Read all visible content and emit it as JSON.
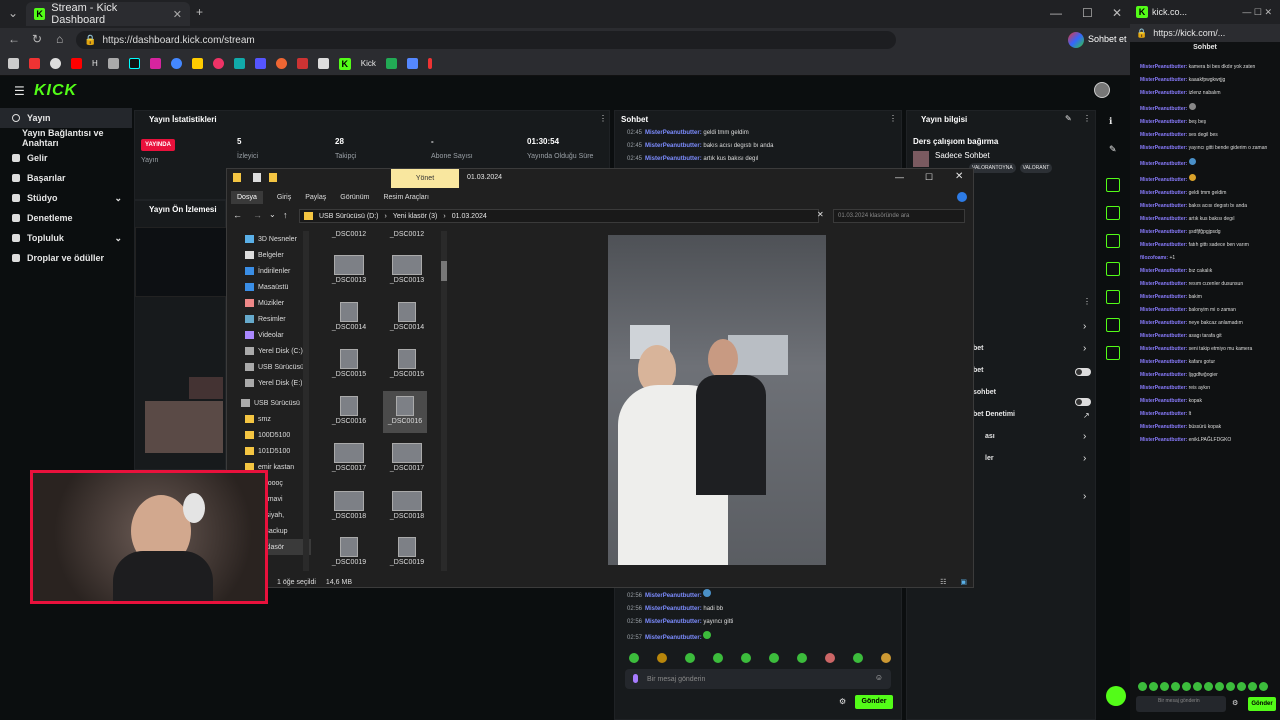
{
  "browser": {
    "tab_title": "Stream - Kick Dashboard",
    "url": "https://dashboard.kick.com/stream",
    "chat_label": "Sohbet et",
    "bookmarks": [
      "H",
      "Kick"
    ]
  },
  "sidebar": {
    "items": [
      {
        "label": "Yayın",
        "active": true
      },
      {
        "label": "Yayın Bağlantısı ve Anahtarı"
      },
      {
        "label": "Gelir"
      },
      {
        "label": "Başarılar"
      },
      {
        "label": "Stüdyo"
      },
      {
        "label": "Denetleme"
      },
      {
        "label": "Topluluk"
      },
      {
        "label": "Droplar ve ödüller"
      }
    ]
  },
  "stats": {
    "title": "Yayın İstatistikleri",
    "status": "YAYINDA",
    "status_label": "Yayın",
    "viewers": "5",
    "viewers_label": "İzleyici",
    "followers": "28",
    "followers_label": "Takipçi",
    "subs": "-",
    "subs_label": "Abone Sayısı",
    "uptime": "01:30:54",
    "uptime_label": "Yayında Olduğu Süre"
  },
  "preview_title": "Yayın Ön İzlemesi",
  "chat": {
    "title": "Sohbet",
    "top_messages": [
      {
        "time": "02:45",
        "user": "MisterPeanutbutter:",
        "text": "geldi tmm geldim"
      },
      {
        "time": "02:45",
        "user": "MisterPeanutbutter:",
        "text": "bakıs acısı degıstı bı anda"
      },
      {
        "time": "02:45",
        "user": "MisterPeanutbutter:",
        "text": "artık kus bakısı degıl"
      }
    ],
    "bottom_messages": [
      {
        "time": "02:56",
        "user": "MisterPeanutbutter:",
        "text": ""
      },
      {
        "time": "02:56",
        "user": "MisterPeanutbutter:",
        "text": "hadi bb"
      },
      {
        "time": "02:56",
        "user": "MisterPeanutbutter:",
        "text": "yayıncı gitti"
      },
      {
        "time": "02:57",
        "user": "MisterPeanutbutter:",
        "text": ""
      }
    ],
    "placeholder": "Bir mesaj gönderin",
    "send": "Gönder"
  },
  "stream_info": {
    "title": "Yayın bilgisi",
    "stream_title": "Ders çalışıom bağırma",
    "category": "Sadece Sohbet",
    "tags": [
      "VALORANTOYNA",
      "VALORANT"
    ],
    "settings": [
      "bet",
      "bet",
      "sohbet",
      "bet Denetimi",
      "ası",
      "ler"
    ]
  },
  "explorer": {
    "manage": "Yönet",
    "folder": "01.03.2024",
    "tabs": [
      "Dosya",
      "Giriş",
      "Paylaş",
      "Görünüm",
      "Resim Araçları"
    ],
    "path": [
      "USB Sürücüsü (D:)",
      "Yeni klasör (3)",
      "01.03.2024"
    ],
    "search": "01.03.2024 klasöründe ara",
    "tree": [
      "3D Nesneler",
      "Belgeler",
      "İndirilenler",
      "Masaüstü",
      "Müzikler",
      "Resimler",
      "Videolar",
      "Yerel Disk (C:)",
      "USB Sürücüsü",
      "Yerel Disk (E:)",
      "USB Sürücüsü",
      "smz",
      "100D5100",
      "101D5100",
      "emir kastan",
      "mooooç",
      "up mavi",
      "upsiyah,",
      "Z Backup",
      "ni klasör"
    ],
    "files": [
      {
        "name": "_DSC0012"
      },
      {
        "name": "_DSC0012"
      },
      {
        "name": "_DSC0013"
      },
      {
        "name": "_DSC0013"
      },
      {
        "name": "_DSC0014"
      },
      {
        "name": "_DSC0014"
      },
      {
        "name": "_DSC0015"
      },
      {
        "name": "_DSC0015"
      },
      {
        "name": "_DSC0016"
      },
      {
        "name": "_DSC0016",
        "selected": true
      },
      {
        "name": "_DSC0017"
      },
      {
        "name": "_DSC0017"
      },
      {
        "name": "_DSC0018"
      },
      {
        "name": "_DSC0018"
      },
      {
        "name": "_DSC0019"
      },
      {
        "name": "_DSC0019"
      }
    ],
    "status_count": "1 öğe seçildi",
    "status_size": "14,6 MB"
  },
  "side_chat": {
    "url": "https://kick.com/...",
    "header": "kick.co...",
    "title": "Sohbet",
    "messages": [
      {
        "user": "MisterPeanutbutter:",
        "text": "kamera bi bes dkdır yok zaten"
      },
      {
        "user": "MisterPeanutbutter:",
        "text": "kaaakfpwgkwrjjg"
      },
      {
        "user": "MisterPeanutbutter:",
        "text": "izlenz nabalım"
      },
      {
        "user": "MisterPeanutbutter:",
        "text": ""
      },
      {
        "user": "MisterPeanutbutter:",
        "text": "beş beş"
      },
      {
        "user": "MisterPeanutbutter:",
        "text": "ses degil bes"
      },
      {
        "user": "MisterPeanutbutter:",
        "text": "yayıncı gitti bende giderim o zaman"
      },
      {
        "user": "MisterPeanutbutter:",
        "text": ""
      },
      {
        "user": "MisterPeanutbutter:",
        "text": ""
      },
      {
        "user": "MisterPeanutbutter:",
        "text": "geldi tmm geldim"
      },
      {
        "user": "MisterPeanutbutter:",
        "text": "bakıs acısı degıstı bı anda"
      },
      {
        "user": "MisterPeanutbutter:",
        "text": "artık kus bakısı degıl"
      },
      {
        "user": "MisterPeanutbutter:",
        "text": "şsdfjfğpgjpsdg"
      },
      {
        "user": "MisterPeanutbutter:",
        "text": "fatıh gittı sadece ben varım"
      },
      {
        "user": "filozofoamı:",
        "text": "+1"
      },
      {
        "user": "MisterPeanutbutter:",
        "text": "bız cakalık"
      },
      {
        "user": "MisterPeanutbutter:",
        "text": "resım cızenler dusunsun"
      },
      {
        "user": "MisterPeanutbutter:",
        "text": "bakim"
      },
      {
        "user": "MisterPeanutbutter:",
        "text": "balonyim mi o zaman"
      },
      {
        "user": "MisterPeanutbutter:",
        "text": "neye bakcaz anlamadım"
      },
      {
        "user": "MisterPeanutbutter:",
        "text": "asagı tarafa git"
      },
      {
        "user": "MisterPeanutbutter:",
        "text": "seni takip etmiyo mu kamera"
      },
      {
        "user": "MisterPeanutbutter:",
        "text": "kafanı gotur"
      },
      {
        "user": "MisterPeanutbutter:",
        "text": "ljşgdfwğogier"
      },
      {
        "user": "MisterPeanutbutter:",
        "text": "reis aykırı"
      },
      {
        "user": "MisterPeanutbutter:",
        "text": "kopak"
      },
      {
        "user": "MisterPeanutbutter:",
        "text": "lt"
      },
      {
        "user": "MisterPeanutbutter:",
        "text": "büssürü kopak"
      },
      {
        "user": "MisterPeanutbutter:",
        "text": "enikLPAĞLFDGKO"
      }
    ],
    "placeholder": "Bir mesaj gönderin",
    "send": "Gönder"
  }
}
